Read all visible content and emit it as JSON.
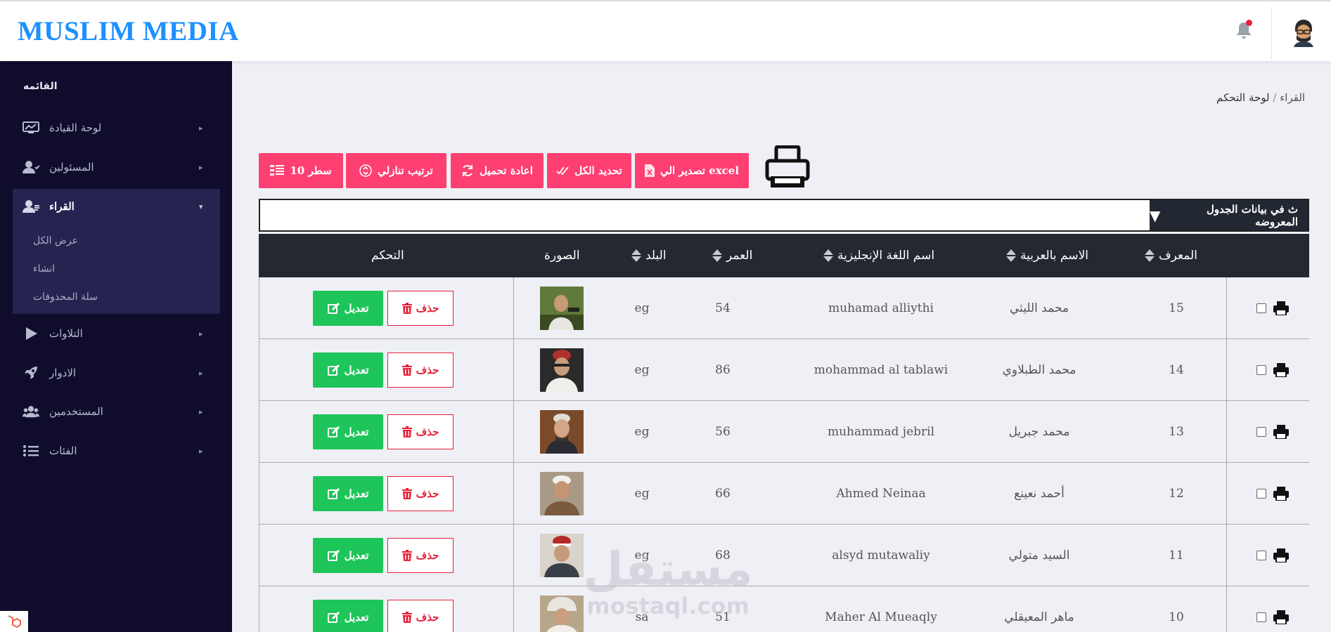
{
  "header": {
    "brand": "MUSLIM MEDIA"
  },
  "sidebar": {
    "heading": "القائمه",
    "items": [
      {
        "label": "لوحة القيادة",
        "icon": "dashboard-icon"
      },
      {
        "label": "المسئولين",
        "icon": "admin-users-icon"
      },
      {
        "label": "القراء",
        "icon": "readers-icon"
      },
      {
        "label": "التلاوات",
        "icon": "play-icon"
      },
      {
        "label": "الادوار",
        "icon": "rocket-icon"
      },
      {
        "label": "المستخدمين",
        "icon": "users-icon"
      },
      {
        "label": "الفئات",
        "icon": "list-icon"
      }
    ],
    "subitems": [
      "عرض الكل",
      "انشاء",
      "سلة المحذوفات"
    ]
  },
  "breadcrumb": {
    "home": "لوحة التحكم",
    "current": "القراء"
  },
  "toolbar": {
    "export": "تصدير الي excel",
    "select_all": "تحديد الكل",
    "reload": "اعادة تحميل",
    "sort_desc": "ترتيب تنازلي",
    "rows": "10 سطر"
  },
  "search": {
    "label": "ث في بيانات الجدول المعروضه"
  },
  "table": {
    "headers": {
      "id": "المعرف",
      "name_ar": "الاسم بالعربية",
      "name_en": "اسم اللغة الإنجليزية",
      "age": "العمر",
      "country": "البلد",
      "photo": "الصورة",
      "control": "التحكم"
    },
    "delete_label": "حذف",
    "edit_label": "تعديل",
    "rows": [
      {
        "id": "15",
        "name_ar": "محمد الليثي",
        "name_en": "muhamad alliythi",
        "age": "54",
        "country": "eg"
      },
      {
        "id": "14",
        "name_ar": "محمد الطبلاوي",
        "name_en": "mohammad al tablawi",
        "age": "86",
        "country": "eg"
      },
      {
        "id": "13",
        "name_ar": "محمد جبريل",
        "name_en": "muhammad jebril",
        "age": "56",
        "country": "eg"
      },
      {
        "id": "12",
        "name_ar": "أحمد نعينع",
        "name_en": "Ahmed Neinaa",
        "age": "66",
        "country": "eg"
      },
      {
        "id": "11",
        "name_ar": "السيد متولي",
        "name_en": "alsyd mutawaliy",
        "age": "68",
        "country": "eg"
      },
      {
        "id": "10",
        "name_ar": "ماهر المعيقلي",
        "name_en": "Maher Al Mueaqly",
        "age": "51",
        "country": "sa"
      }
    ]
  },
  "watermark": {
    "line1": "مستقل",
    "line2": "mostaql.com"
  }
}
